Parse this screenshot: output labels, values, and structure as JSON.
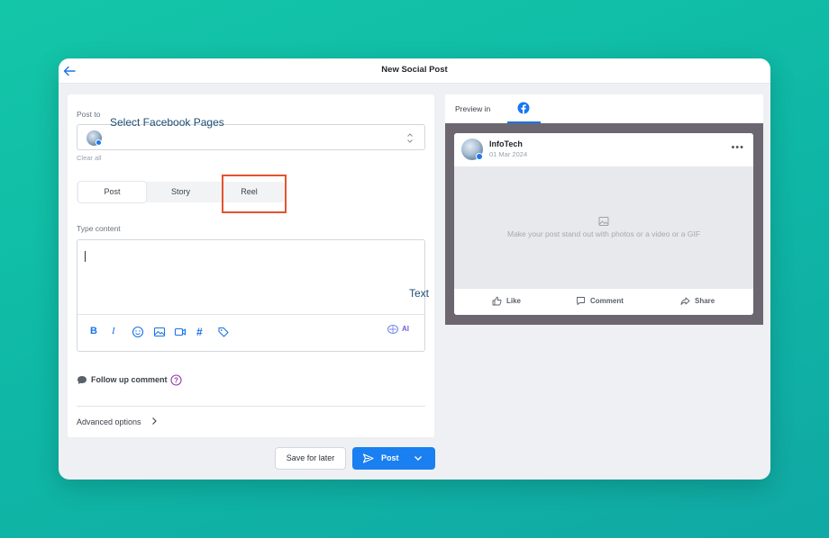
{
  "window": {
    "title": "New Social Post"
  },
  "compose": {
    "post_to_label": "Post to",
    "select_overlay": "Select Facebook Pages",
    "clear_all": "Clear all",
    "tabs": [
      {
        "label": "Post",
        "active": true
      },
      {
        "label": "Story",
        "active": false
      },
      {
        "label": "Reel",
        "active": false
      }
    ],
    "content_label": "Type content",
    "content_value": "",
    "text_overlay": "Text",
    "toolbar": [
      {
        "icon": "bold-icon",
        "glyph": "B"
      },
      {
        "icon": "italic-icon",
        "glyph": "I"
      },
      {
        "icon": "emoji-icon"
      },
      {
        "icon": "image-icon"
      },
      {
        "icon": "video-icon"
      },
      {
        "icon": "hashtag-icon",
        "glyph": "#"
      },
      {
        "icon": "tag-icon"
      }
    ],
    "ai_label": "AI",
    "follow_up": "Follow up comment",
    "advanced": "Advanced options"
  },
  "buttons": {
    "save_later": "Save for later",
    "post": "Post"
  },
  "preview": {
    "label": "Preview in",
    "card": {
      "name": "InfoTech",
      "date": "01 Mar 2024",
      "placeholder": "Make your post stand out with photos or a video or a GIF",
      "actions": [
        "Like",
        "Comment",
        "Share"
      ]
    }
  },
  "colors": {
    "background": "#12bfa6",
    "primary": "#1a7ff0",
    "highlight": "#e4532d",
    "preview_bg": "#6c6670",
    "facebook": "#1877f2"
  }
}
